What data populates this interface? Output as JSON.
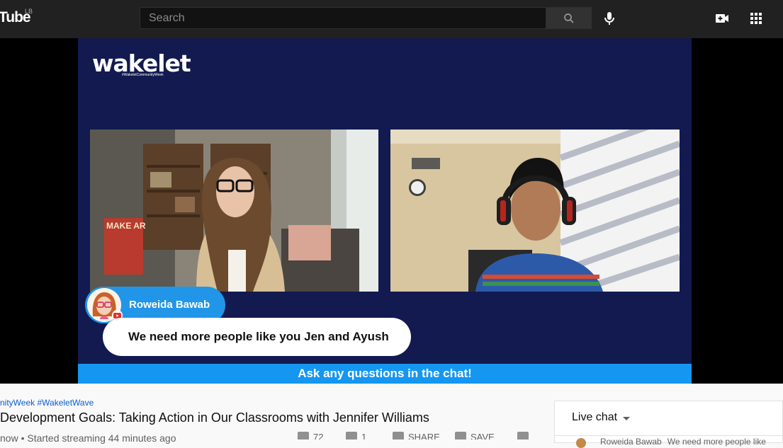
{
  "masthead": {
    "logo_text": "Tube",
    "region": "LB",
    "search_placeholder": "Search"
  },
  "video_frame": {
    "brand": "wakelet",
    "brand_hashtag": "#WakeletCommunityWeek",
    "poster_sign": "MAKE AR",
    "comment_author": "Roweida Bawab",
    "comment_text": "We need more people like you Jen and Ayush",
    "banner_text": "Ask any questions in the chat!"
  },
  "video_info": {
    "hashtags": "nityWeek #WakeletWave",
    "title": " Development Goals: Taking Action in Our Classrooms with Jennifer Williams",
    "meta": "now • Started streaming 44 minutes ago",
    "likes": "72",
    "dislikes": "1",
    "share_label": "SHARE",
    "save_label": "SAVE"
  },
  "live_chat": {
    "header": "Live chat",
    "first_message_author": "Roweida Bawab",
    "first_message_text": "We need more people like"
  },
  "colors": {
    "masthead_bg": "#212121",
    "frame_bg": "#121a4f",
    "accent_blue": "#2196e8",
    "banner_blue": "#1596f0",
    "link_blue": "#065fd4"
  }
}
